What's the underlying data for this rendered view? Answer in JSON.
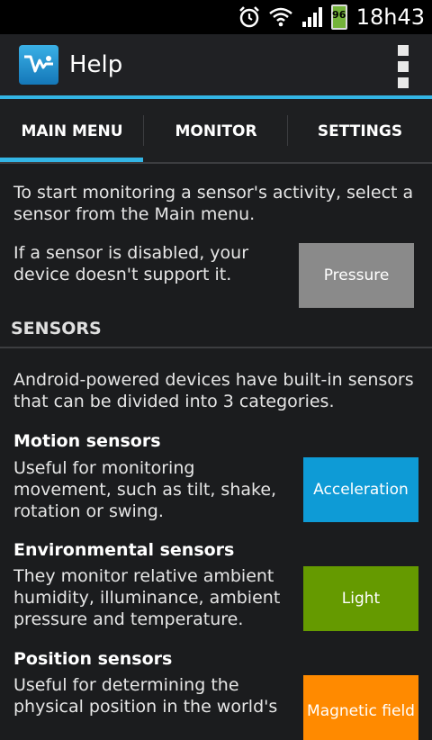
{
  "status_bar": {
    "time": "18h43",
    "battery": "96",
    "icons": [
      "alarm-icon",
      "wifi-icon",
      "signal-icon",
      "battery-icon"
    ]
  },
  "action_bar": {
    "title": "Help",
    "app_icon": "app-logo-icon",
    "overflow_icon": "overflow-menu-icon"
  },
  "tabs": [
    {
      "label": "MAIN MENU",
      "selected": true
    },
    {
      "label": "MONITOR",
      "selected": false
    },
    {
      "label": "SETTINGS",
      "selected": false
    }
  ],
  "intro": {
    "text1": "To start monitoring a sensor's activity, select a sensor from the Main menu.",
    "text2": "If a sensor is disabled, your device doesn't support it.",
    "disabled_button": "Pressure"
  },
  "sensors_section": {
    "header": "SENSORS",
    "intro": "Android-powered devices have built-in sensors that can be divided into 3 categories.",
    "categories": [
      {
        "title": "Motion sensors",
        "desc": "Useful for monitoring movement, such as tilt, shake, rotation or swing.",
        "button": "Acceleration",
        "color": "#0e9bd6"
      },
      {
        "title": "Environmental sensors",
        "desc": "They monitor relative ambient humidity, illuminance, ambient pressure and temperature.",
        "button": "Light",
        "color": "#659a00"
      },
      {
        "title": "Position sensors",
        "desc": "Useful for determining the physical position in the world's",
        "button": "Magnetic field",
        "color": "#ff8a00"
      }
    ]
  },
  "colors": {
    "accent": "#33b5e5",
    "disabled_button": "#8a8a8a"
  }
}
